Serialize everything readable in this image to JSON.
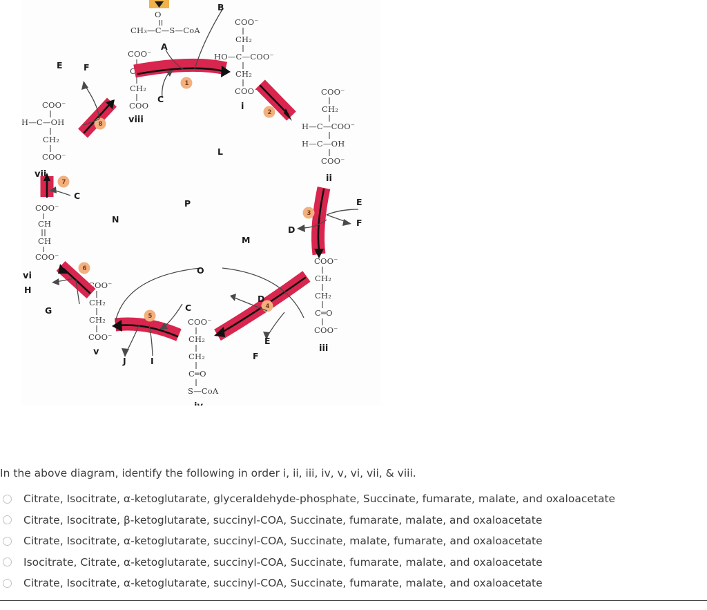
{
  "figure": {
    "title": "citric-acid-cycle-diagram",
    "top_marker": {
      "shape": "down-triangle",
      "box_color": "#f0b24a",
      "glyph": "▼"
    },
    "colors": {
      "arrow_band": "#d8264e",
      "arrow_band_light": "#e4436a",
      "step_circle": "#f2b07f",
      "bond": "#555555",
      "chem_text": "#3b3b3b",
      "label_text": "#1c1c1c"
    },
    "intermediates": [
      {
        "roman": "viii",
        "name_lines": [
          "COO⁻",
          "C═O",
          "CH₂",
          "COO"
        ]
      },
      {
        "roman": "i",
        "name_lines": [
          "COO⁻",
          "CH₂",
          "HO—C—COO⁻",
          "CH₂",
          "COO⁻"
        ]
      },
      {
        "roman": "ii",
        "name_lines": [
          "COO⁻",
          "CH₂",
          "H—C—COO⁻",
          "H—C—OH",
          "COO⁻"
        ]
      },
      {
        "roman": "iii",
        "name_lines": [
          "COO⁻",
          "CH₂",
          "CH₂",
          "C═O",
          "COO⁻"
        ]
      },
      {
        "roman": "iv",
        "name_lines": [
          "COO⁻",
          "CH₂",
          "CH₂",
          "C═O",
          "S—CoA"
        ]
      },
      {
        "roman": "v",
        "name_lines": [
          "COO⁻",
          "CH₂",
          "CH₂",
          "COO⁻"
        ]
      },
      {
        "roman": "vi",
        "name_lines": [
          "COO⁻",
          "CH",
          "CH",
          "COO⁻"
        ]
      },
      {
        "roman": "vii",
        "name_lines": [
          "COO⁻",
          "H—C—OH",
          "CH₂",
          "COO⁻"
        ]
      }
    ],
    "acetyl_coa_formula": {
      "o_atom": "O",
      "chain": "CH₃—C—S—CoA"
    },
    "step_numbers": [
      "1",
      "2",
      "3",
      "4",
      "5",
      "6",
      "7",
      "8"
    ],
    "letter_labels": [
      "A",
      "B",
      "C",
      "D",
      "E",
      "F",
      "G",
      "H",
      "I",
      "J",
      "L",
      "M",
      "N",
      "O",
      "P"
    ]
  },
  "question": {
    "prompt": "In the above diagram, identify the following in order i, ii, iii, iv, v, vi, vii, & viii.",
    "choices": [
      "Citrate, Isocitrate, α-ketoglutarate, glyceraldehyde-phosphate, Succinate, fumarate, malate, and oxaloacetate",
      "Citrate, Isocitrate, β-ketoglutarate, succinyl-COA, Succinate, fumarate, malate, and oxaloacetate",
      "Citrate, Isocitrate, α-ketoglutarate, succinyl-COA, Succinate, malate, fumarate, and oxaloacetate",
      "Isocitrate, Citrate, α-ketoglutarate, succinyl-COA, Succinate, fumarate, malate, and oxaloacetate",
      "Citrate, Isocitrate, α-ketoglutarate, succinyl-COA, Succinate, fumarate, malate, and oxaloacetate"
    ],
    "selected_index": null
  }
}
